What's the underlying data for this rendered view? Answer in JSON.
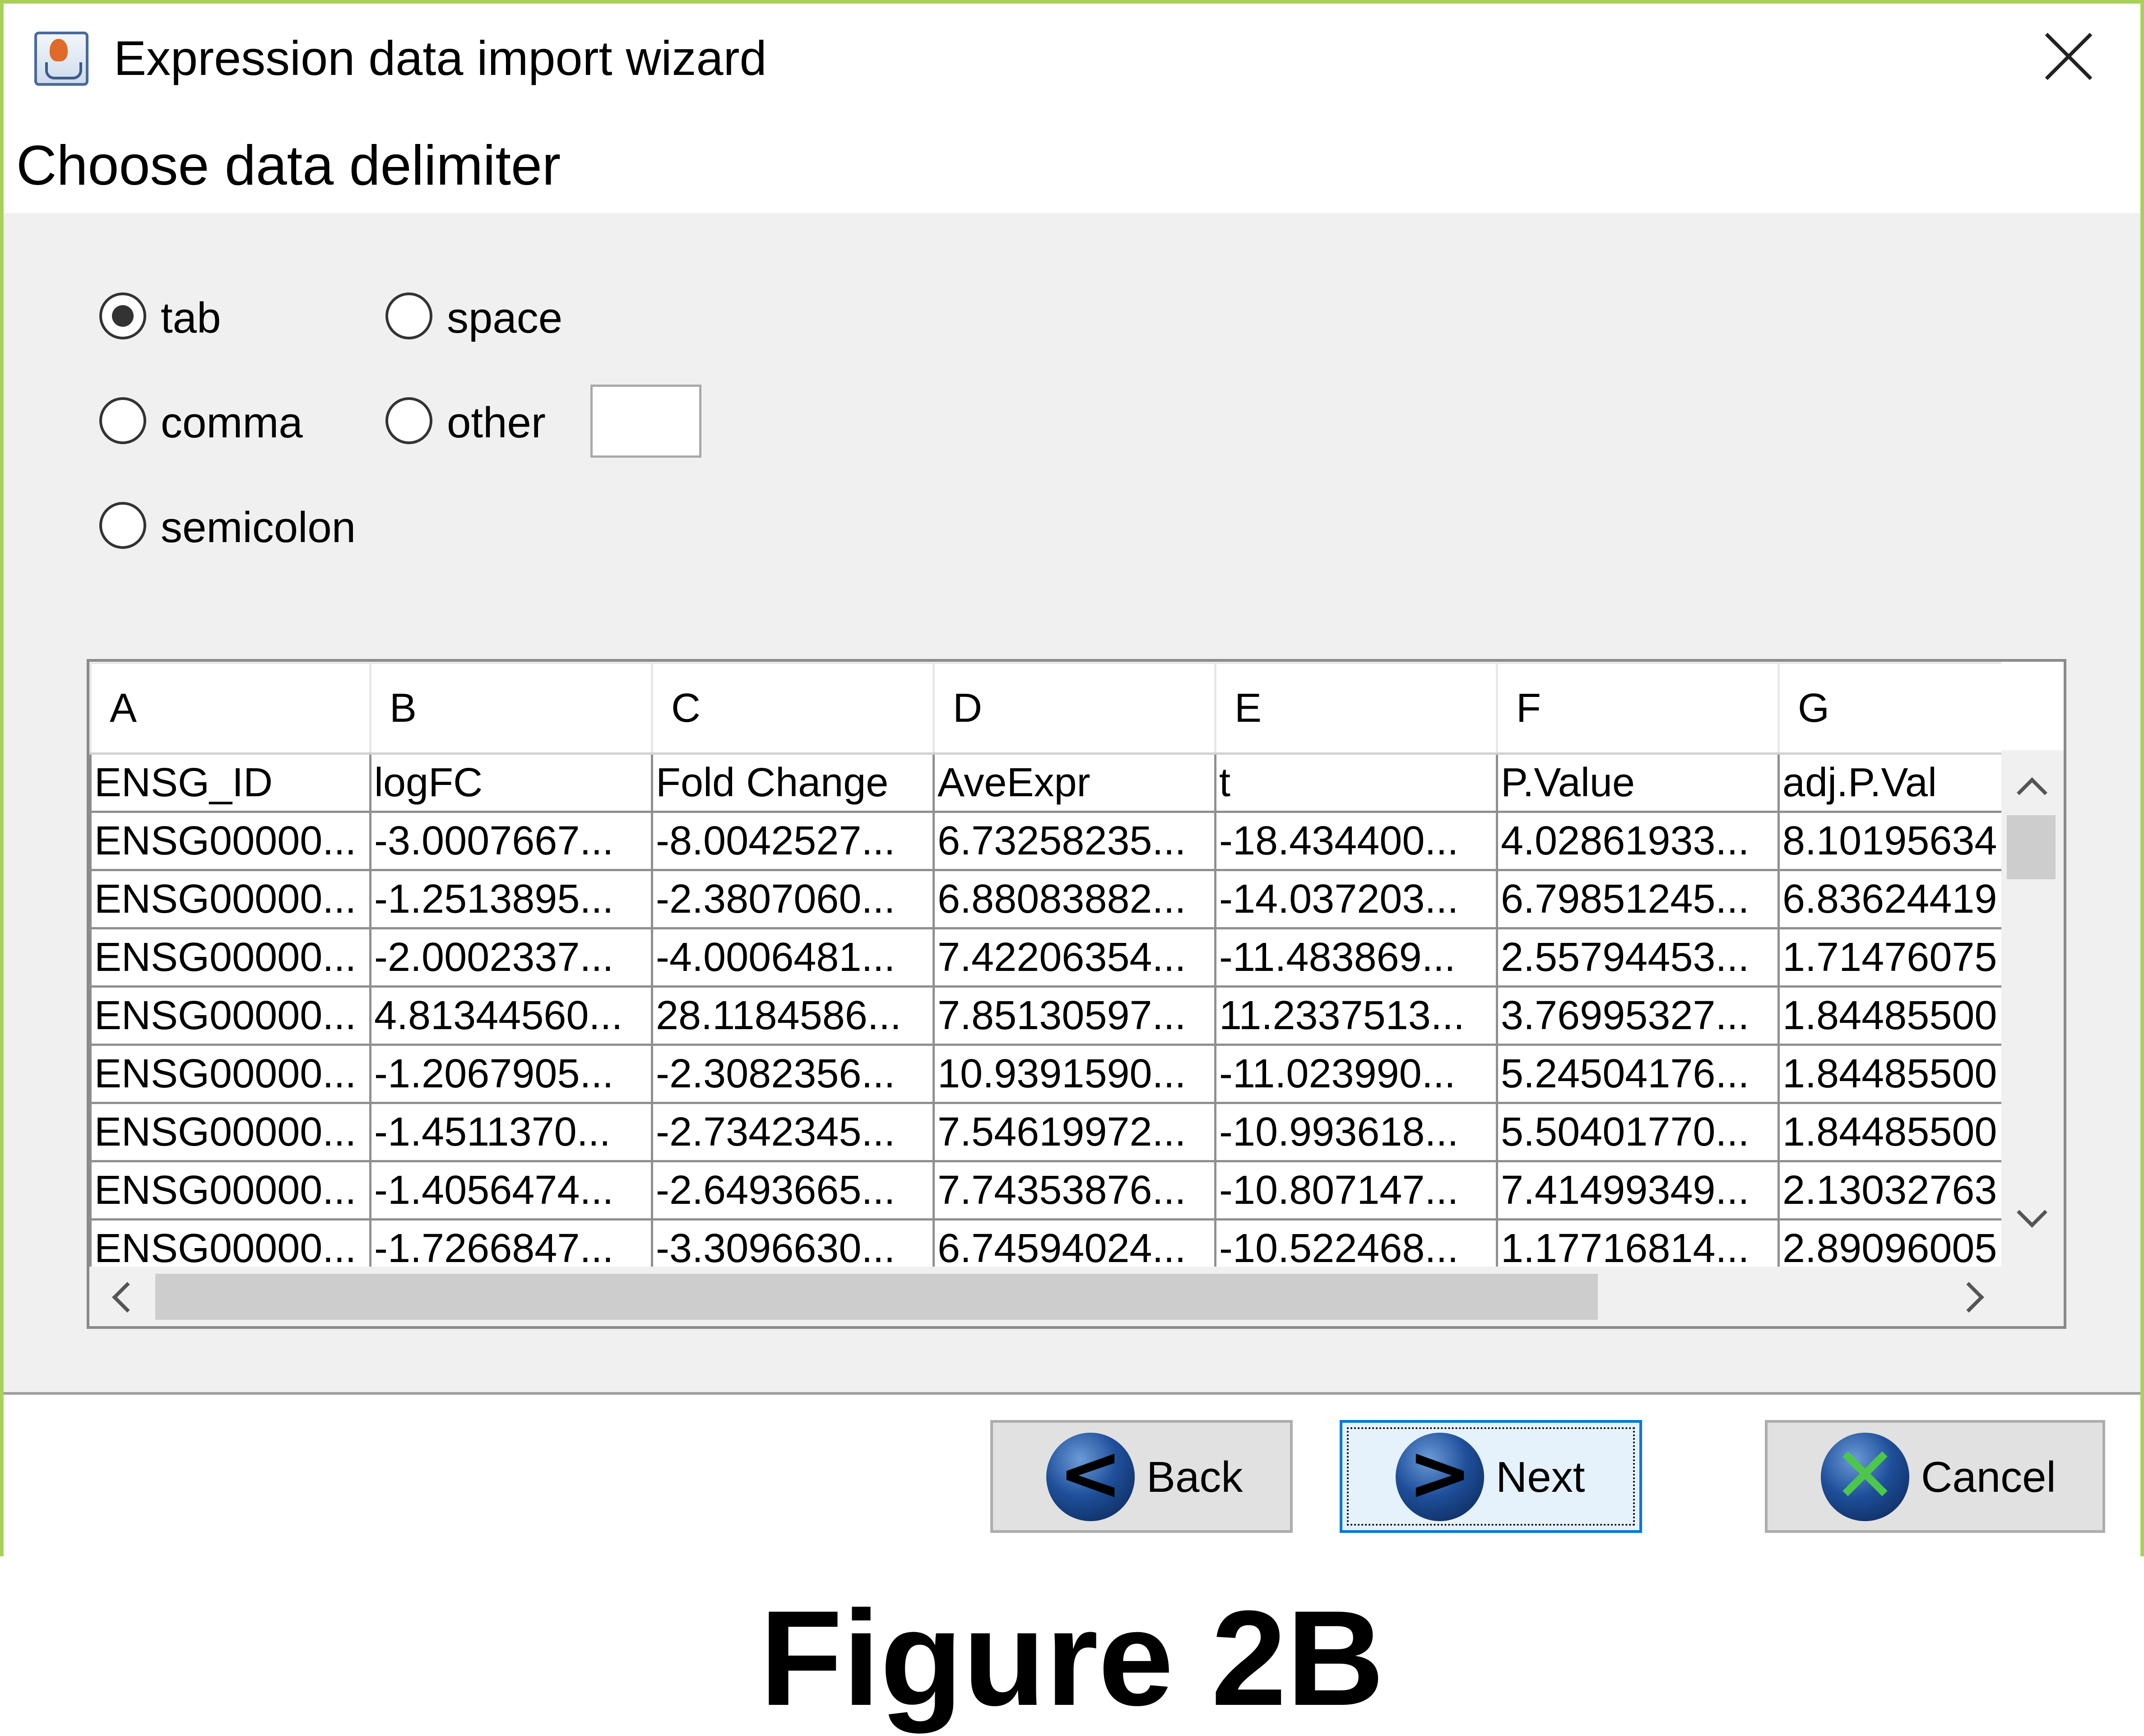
{
  "window": {
    "title": "Expression data import wizard"
  },
  "heading": "Choose data delimiter",
  "delimiters": {
    "tab": "tab",
    "space": "space",
    "comma": "comma",
    "other": "other",
    "semicolon": "semicolon",
    "selected": "tab",
    "other_value": ""
  },
  "table": {
    "column_letters": [
      "A",
      "B",
      "C",
      "D",
      "E",
      "F",
      "G"
    ],
    "header_row": [
      "ENSG_ID",
      "logFC",
      "Fold Change",
      "AveExpr",
      "t",
      "P.Value",
      "adj.P.Val"
    ],
    "rows": [
      [
        "ENSG00000...",
        "-3.0007667...",
        "-8.0042527...",
        "6.73258235...",
        "-18.434400...",
        "4.02861933...",
        "8.10195634"
      ],
      [
        "ENSG00000...",
        "-1.2513895...",
        "-2.3807060...",
        "6.88083882...",
        "-14.037203...",
        "6.79851245...",
        "6.83624419"
      ],
      [
        "ENSG00000...",
        "-2.0002337...",
        "-4.0006481...",
        "7.42206354...",
        "-11.483869...",
        "2.55794453...",
        "1.71476075"
      ],
      [
        "ENSG00000...",
        "4.81344560...",
        "28.1184586...",
        "7.85130597...",
        "11.2337513...",
        "3.76995327...",
        "1.84485500"
      ],
      [
        "ENSG00000...",
        "-1.2067905...",
        "-2.3082356...",
        "10.9391590...",
        "-11.023990...",
        "5.24504176...",
        "1.84485500"
      ],
      [
        "ENSG00000...",
        "-1.4511370...",
        "-2.7342345...",
        "7.54619972...",
        "-10.993618...",
        "5.50401770...",
        "1.84485500"
      ],
      [
        "ENSG00000...",
        "-1.4056474...",
        "-2.6493665...",
        "7.74353876...",
        "-10.807147...",
        "7.41499349...",
        "2.13032763"
      ],
      [
        "ENSG00000...",
        "-1.7266847...",
        "-3.3096630...",
        "6.74594024...",
        "-10.522468...",
        "1.17716814...",
        "2.89096005"
      ]
    ]
  },
  "buttons": {
    "back": "Back",
    "next": "Next",
    "cancel": "Cancel"
  },
  "icons": {
    "app": "java-cup-icon",
    "back": "back-arrow-icon",
    "next": "next-arrow-icon",
    "cancel": "cancel-x-icon",
    "close": "close-icon"
  },
  "caption": "Figure 2B",
  "colors": {
    "window_border": "#a9d15a",
    "focus": "#0078d7",
    "panel": "#f0f0f0"
  }
}
